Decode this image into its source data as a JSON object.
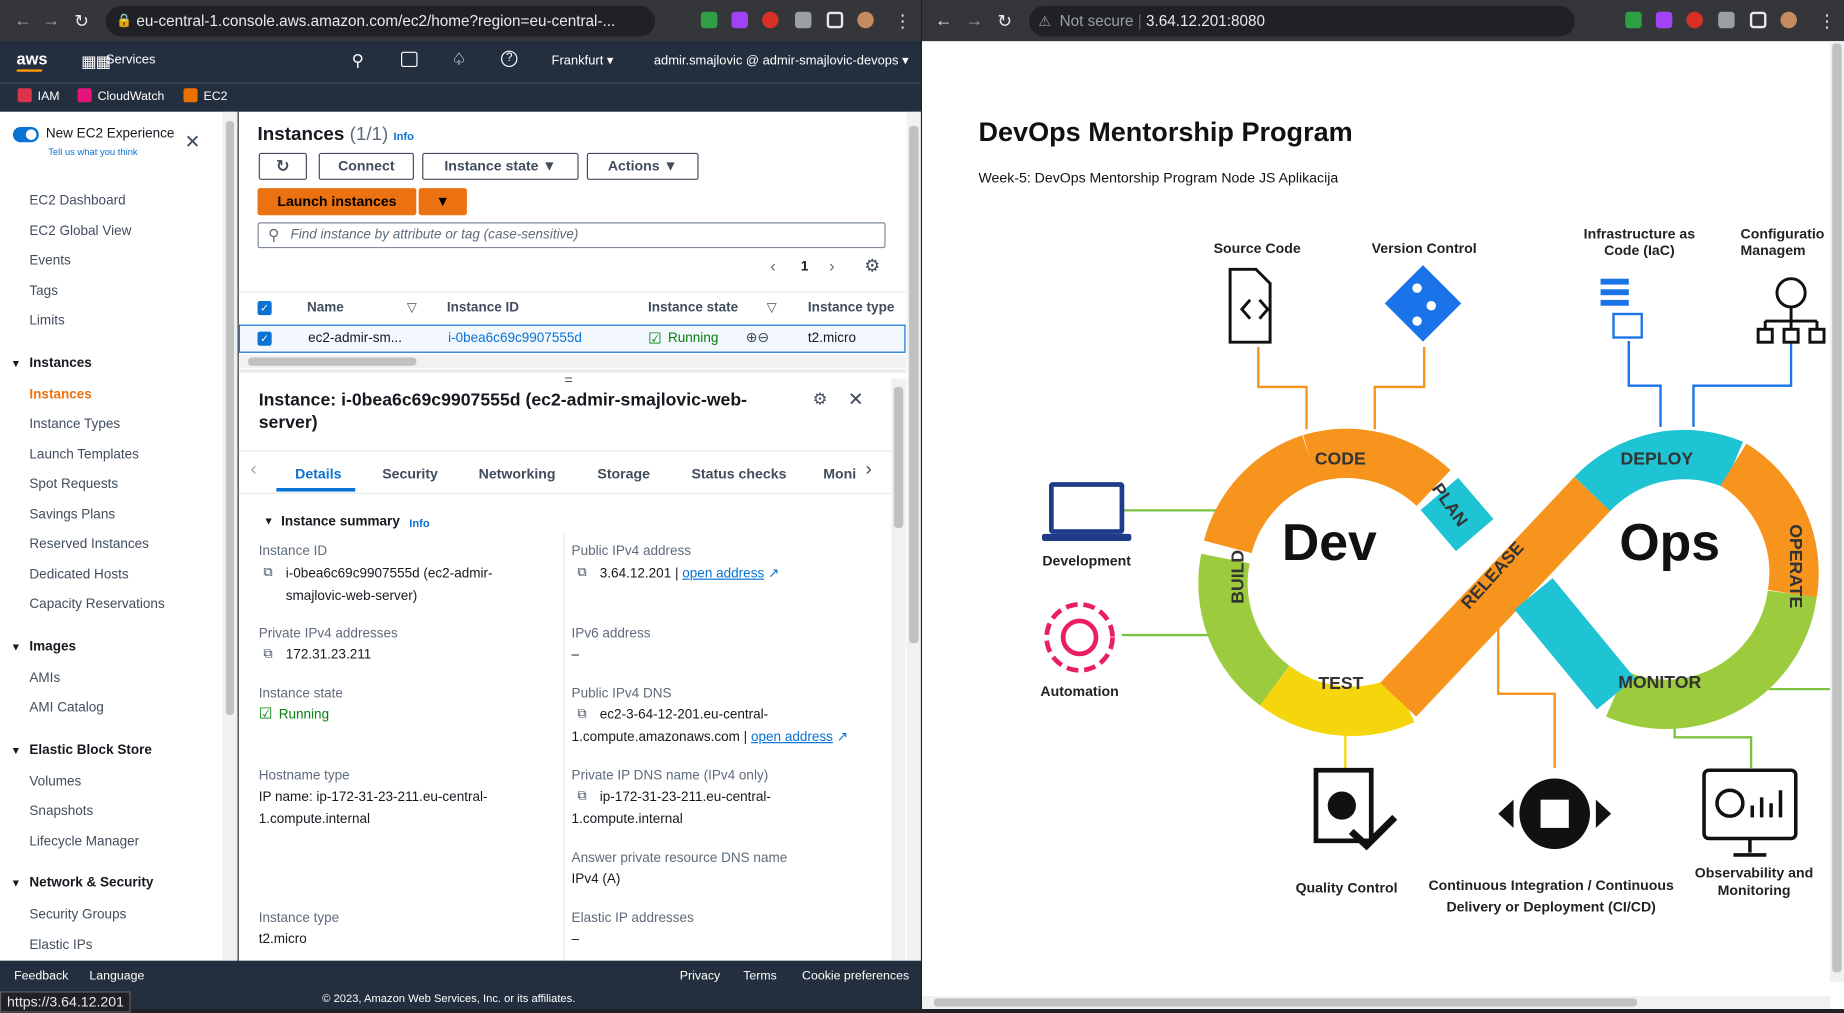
{
  "left_tab": {
    "url": "eu-central-1.console.aws.amazon.com/ec2/home?region=eu-central-...",
    "status_url": "https://3.64.12.201"
  },
  "aws_header": {
    "services": "Services",
    "region": "Frankfurt",
    "account": "admir.smajlovic @ admir-smajlovic-devops",
    "favorites": [
      "IAM",
      "CloudWatch",
      "EC2"
    ],
    "colors": {
      "topbar": "#232f3e",
      "accent": "#ec7211",
      "link": "#0972d3"
    }
  },
  "sidebar": {
    "experience_label": "New EC2 Experience",
    "experience_sub": "Tell us what you think",
    "top_items": [
      "EC2 Dashboard",
      "EC2 Global View",
      "Events",
      "Tags",
      "Limits"
    ],
    "sections": [
      {
        "title": "Instances",
        "items": [
          "Instances",
          "Instance Types",
          "Launch Templates",
          "Spot Requests",
          "Savings Plans",
          "Reserved Instances",
          "Dedicated Hosts",
          "Capacity Reservations"
        ]
      },
      {
        "title": "Images",
        "items": [
          "AMIs",
          "AMI Catalog"
        ]
      },
      {
        "title": "Elastic Block Store",
        "items": [
          "Volumes",
          "Snapshots",
          "Lifecycle Manager"
        ]
      },
      {
        "title": "Network & Security",
        "items": [
          "Security Groups",
          "Elastic IPs"
        ]
      }
    ]
  },
  "instances": {
    "title": "Instances",
    "count": "(1/1)",
    "info": "Info",
    "connect": "Connect",
    "instance_state": "Instance state",
    "actions": "Actions",
    "launch": "Launch instances",
    "search_placeholder": "Find instance by attribute or tag (case-sensitive)",
    "page": "1",
    "columns": [
      "Name",
      "Instance ID",
      "Instance state",
      "Instance type"
    ],
    "row": {
      "name": "ec2-admir-sm...",
      "id": "i-0bea6c69c9907555d",
      "state": "Running",
      "type": "t2.micro"
    }
  },
  "detail": {
    "title": "Instance: i-0bea6c69c9907555d (ec2-admir-smajlovic-web-server)",
    "tabs": [
      "Details",
      "Security",
      "Networking",
      "Storage",
      "Status checks",
      "Moni"
    ],
    "summary": "Instance summary",
    "info": "Info",
    "left_fields": [
      {
        "label": "Instance ID",
        "value": "i-0bea6c69c9907555d (ec2-admir-smajlovic-web-server)"
      },
      {
        "label": "Private IPv4 addresses",
        "value": "172.31.23.211"
      },
      {
        "label": "Instance state",
        "value": "Running"
      },
      {
        "label": "Hostname type",
        "value": "IP name: ip-172-31-23-211.eu-central-1.compute.internal"
      },
      {
        "label": "Instance type",
        "value": "t2.micro"
      }
    ],
    "right_fields": [
      {
        "label": "Public IPv4 address",
        "value": "3.64.12.201 |",
        "link": "open address"
      },
      {
        "label": "IPv6 address",
        "value": "–"
      },
      {
        "label": "Public IPv4 DNS",
        "value": "ec2-3-64-12-201.eu-central-1.compute.amazonaws.com |",
        "link": "open address"
      },
      {
        "label": "Private IP DNS name (IPv4 only)",
        "value": "ip-172-31-23-211.eu-central-1.compute.internal"
      },
      {
        "label": "Answer private resource DNS name",
        "value": "IPv4 (A)"
      },
      {
        "label": "Elastic IP addresses",
        "value": "–"
      }
    ]
  },
  "footer": {
    "feedback": "Feedback",
    "language": "Language",
    "privacy": "Privacy",
    "terms": "Terms",
    "cookies": "Cookie preferences",
    "copyright": "© 2023, Amazon Web Services, Inc. or its affiliates."
  },
  "right_tab": {
    "not_secure": "Not secure",
    "url": "3.64.12.201:8080"
  },
  "devops": {
    "heading": "DevOps Mentorship Program",
    "subheading": "Week-5: DevOps Mentorship Program Node JS Aplikacija",
    "loop_words": [
      "Dev",
      "Ops"
    ],
    "stages": [
      "CODE",
      "PLAN",
      "BUILD",
      "TEST",
      "RELEASE",
      "DEPLOY",
      "OPERATE",
      "MONITOR"
    ],
    "labels": {
      "source_code": "Source Code",
      "version_control": "Version Control",
      "iac": "Infrastructure as Code (IaC)",
      "config": "Configuratio Managem",
      "development": "Development",
      "automation": "Automation",
      "quality": "Quality Control",
      "cicd": "Continuous Integration / Continuous Delivery or Deployment (CI/CD)",
      "observability": "Observability and Monitoring"
    }
  }
}
